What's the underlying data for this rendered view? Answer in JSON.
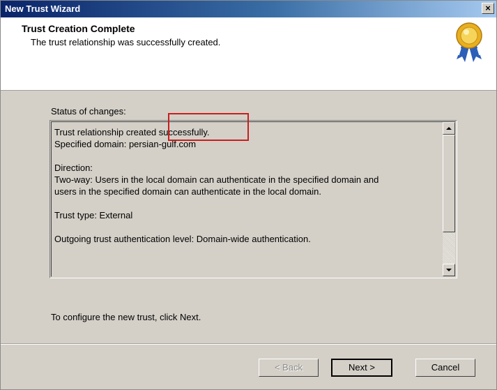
{
  "window": {
    "title": "New Trust Wizard",
    "close_label": "×"
  },
  "header": {
    "title": "Trust Creation Complete",
    "subtitle": "The trust relationship was successfully created.",
    "icon": "award-seal-icon"
  },
  "status": {
    "label": "Status of changes:",
    "line1": "Trust relationship created successfully.",
    "line2": "Specified domain: persian-gulf.com",
    "direction_label": "Direction:",
    "direction_line1": "Two-way: Users in the local domain can authenticate in the specified domain and",
    "direction_line2": "users in the specified domain can authenticate in the local domain.",
    "trust_type": "Trust type: External",
    "auth_level": "Outgoing trust authentication level: Domain-wide authentication."
  },
  "hint": "To configure the new trust, click Next.",
  "buttons": {
    "back": "< Back",
    "next": "Next >",
    "cancel": "Cancel"
  },
  "colors": {
    "highlight": "#c81e1e",
    "titlebar": "#0a246a",
    "dialog_bg": "#d4d0c8"
  }
}
